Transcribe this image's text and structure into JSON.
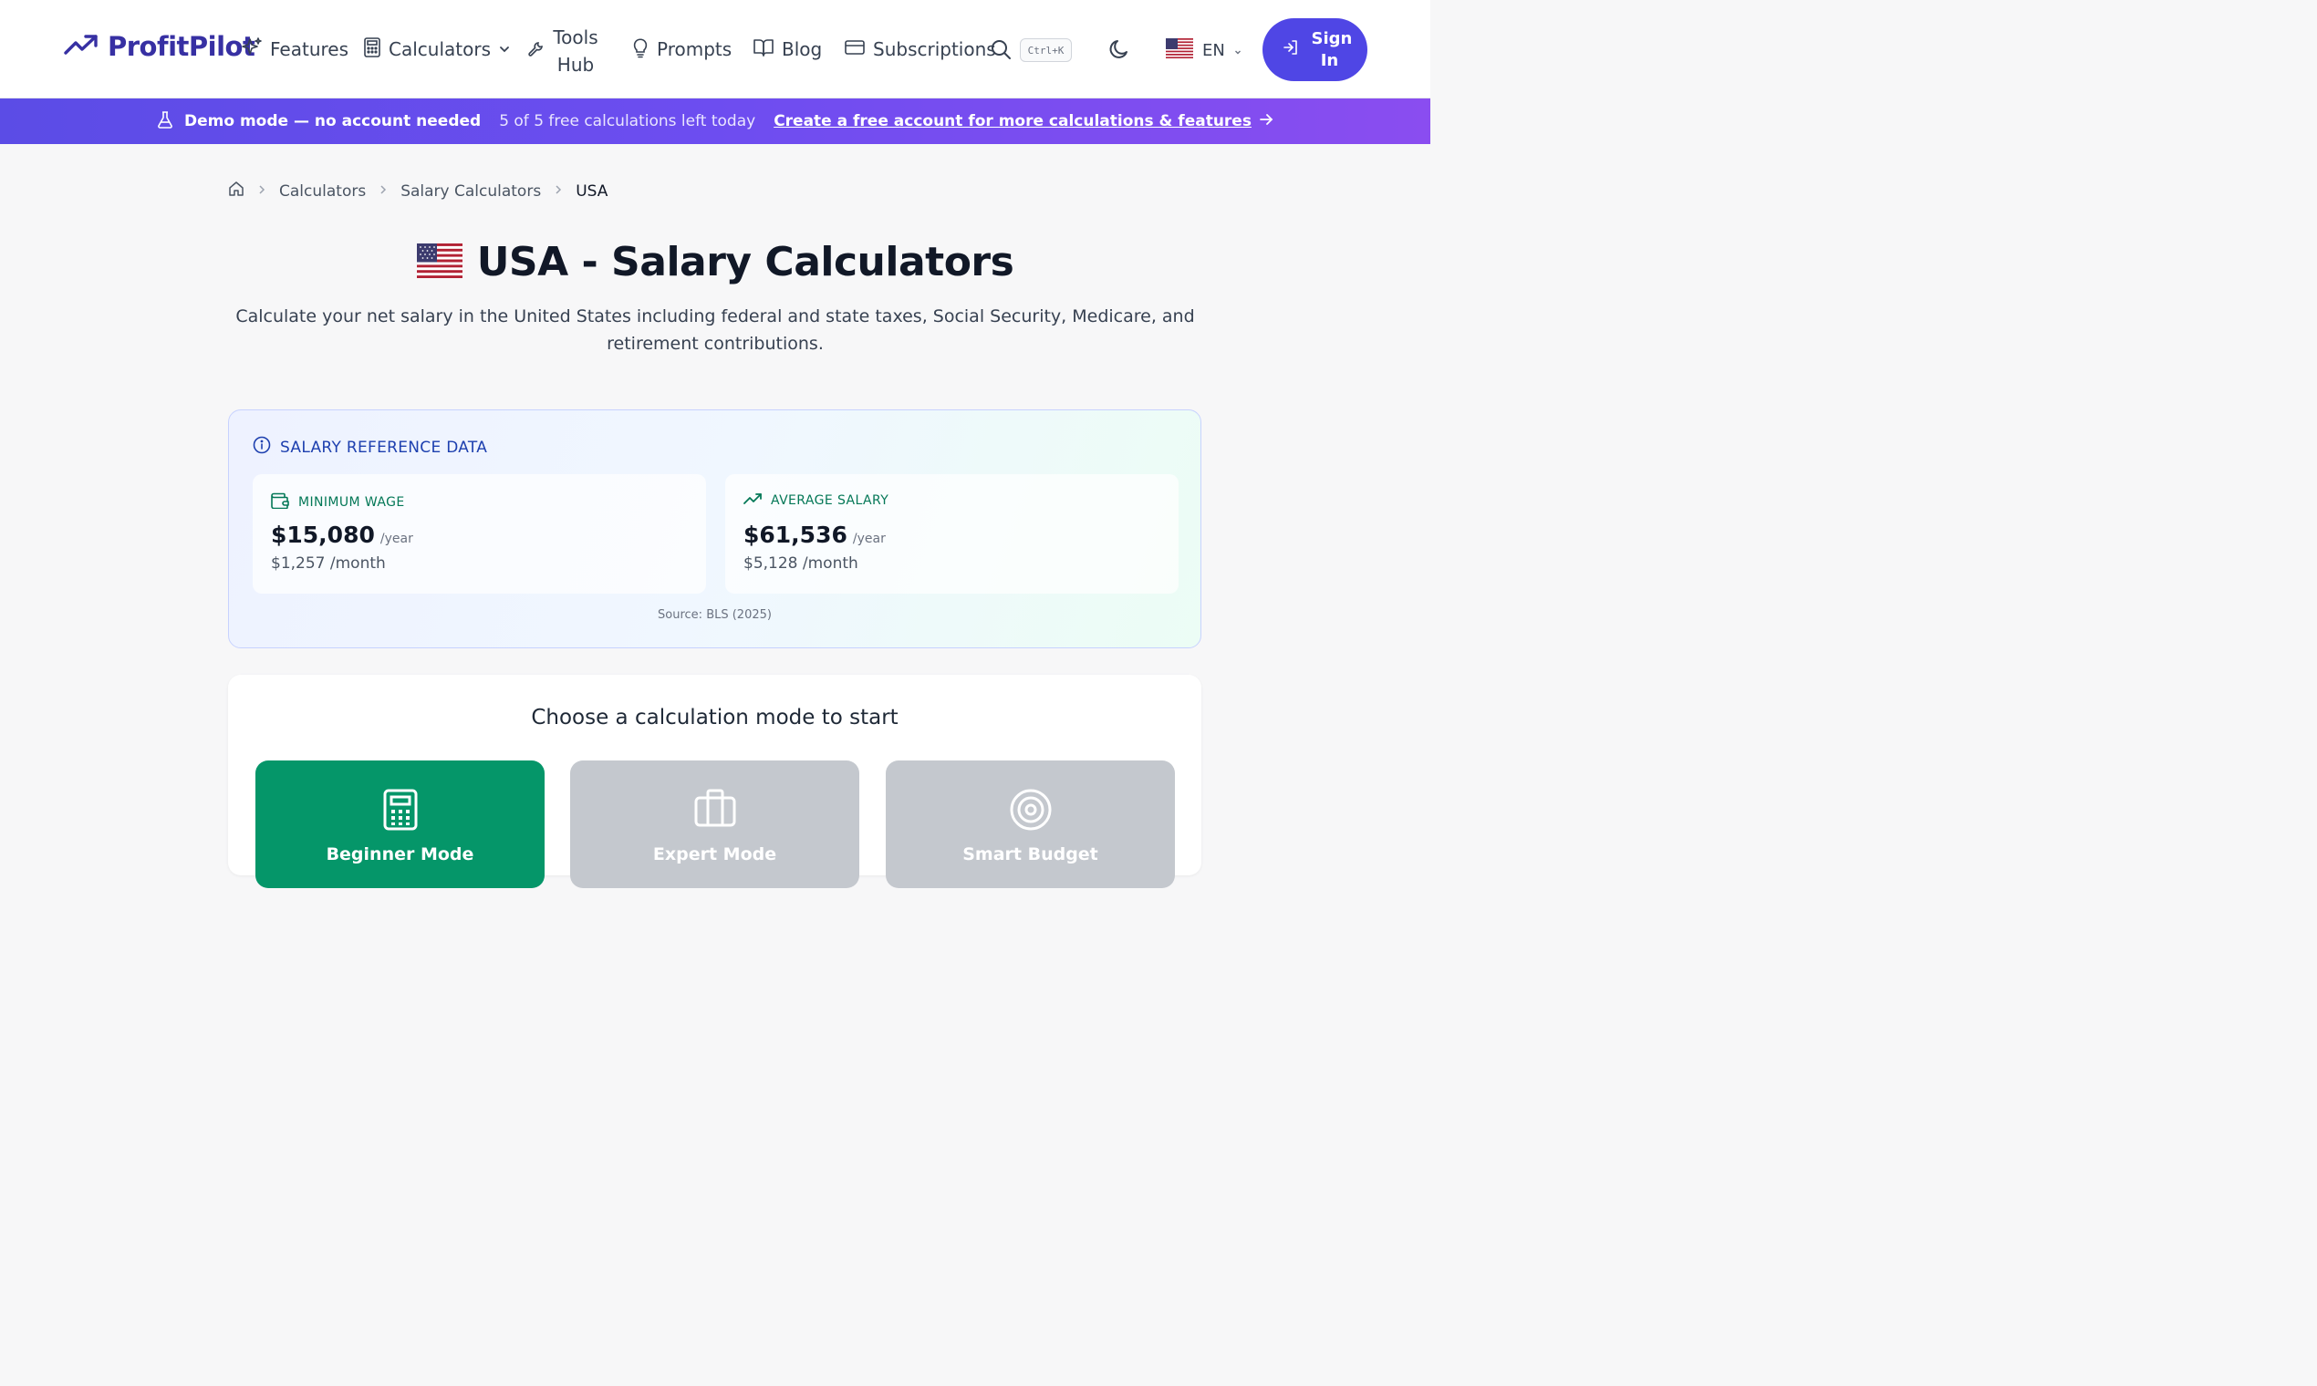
{
  "header": {
    "logo_text": "ProfitPilot",
    "nav": {
      "features": "Features",
      "calculators": "Calculators",
      "tools_hub": "Tools Hub",
      "prompts": "Prompts",
      "blog": "Blog",
      "subscriptions": "Subscriptions"
    },
    "search_shortcut": "Ctrl+K",
    "language": "EN",
    "sign_in": "Sign In"
  },
  "banner": {
    "demo": "Demo mode — no account needed",
    "remaining": "5 of 5 free calculations left today",
    "cta": "Create a free account for more calculations & features"
  },
  "breadcrumb": {
    "items": [
      "Calculators",
      "Salary Calculators"
    ],
    "current": "USA"
  },
  "page": {
    "title": "USA - Salary Calculators",
    "subtitle": "Calculate your net salary in the United States including federal and state taxes, Social Security, Medicare, and retirement contributions."
  },
  "reference": {
    "heading": "SALARY REFERENCE DATA",
    "minimum_wage": {
      "label": "MINIMUM WAGE",
      "yearly": "$15,080",
      "unit": "/year",
      "monthly": "$1,257 /month"
    },
    "average_salary": {
      "label": "AVERAGE SALARY",
      "yearly": "$61,536",
      "unit": "/year",
      "monthly": "$5,128 /month"
    },
    "source": "Source: BLS (2025)"
  },
  "modes": {
    "heading": "Choose a calculation mode to start",
    "items": [
      "Beginner Mode",
      "Expert Mode",
      "Smart Budget"
    ]
  },
  "colors": {
    "brand": "#4f46e5",
    "logo": "#3730a3",
    "mode_active": "#059669",
    "mode_inactive": "#c4c8ce"
  }
}
